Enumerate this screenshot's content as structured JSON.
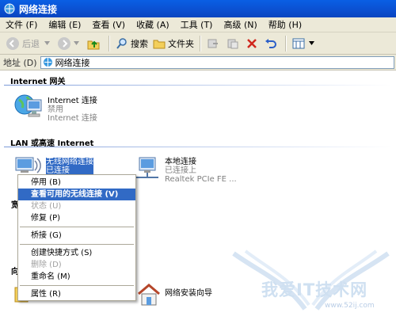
{
  "window": {
    "title": "网络连接"
  },
  "menubar": [
    {
      "label": "文件 (F)"
    },
    {
      "label": "编辑 (E)"
    },
    {
      "label": "查看 (V)"
    },
    {
      "label": "收藏 (A)"
    },
    {
      "label": "工具 (T)"
    },
    {
      "label": "高级 (N)"
    },
    {
      "label": "帮助 (H)"
    }
  ],
  "toolbar": {
    "back_label": "后退",
    "search_label": "搜索",
    "folders_label": "文件夹"
  },
  "address": {
    "label": "地址 (D)",
    "value": "网络连接"
  },
  "groups": {
    "internet_gateway": "Internet 网关",
    "lan": "LAN 或高速 Internet",
    "wizard_partial": "向",
    "broadband_partial": "宽"
  },
  "items": {
    "internet_connection": {
      "name": "Internet 连接",
      "status": "禁用",
      "type": "Internet 连接"
    },
    "wireless": {
      "name": "无线网络连接",
      "status": "已连接"
    },
    "local": {
      "name": "本地连接",
      "status": "已连接上",
      "device": "Realtek PCIe FE ..."
    },
    "wizard": {
      "name": "网络安装向导"
    }
  },
  "context_menu": {
    "disable": "停用 (B)",
    "view_wireless": "查看可用的无线连接 (V)",
    "status": "状态 (U)",
    "repair": "修复 (P)",
    "bridge": "桥接 (G)",
    "shortcut": "创建快捷方式 (S)",
    "delete": "删除 (D)",
    "rename": "重命名 (M)",
    "properties": "属性 (R)"
  },
  "watermark": {
    "text": "我爱IT技术网",
    "url": "www.52ij.com"
  },
  "colors": {
    "titlebar": "#0b4fd0",
    "selection": "#316ac5",
    "chrome": "#ece9d8"
  }
}
